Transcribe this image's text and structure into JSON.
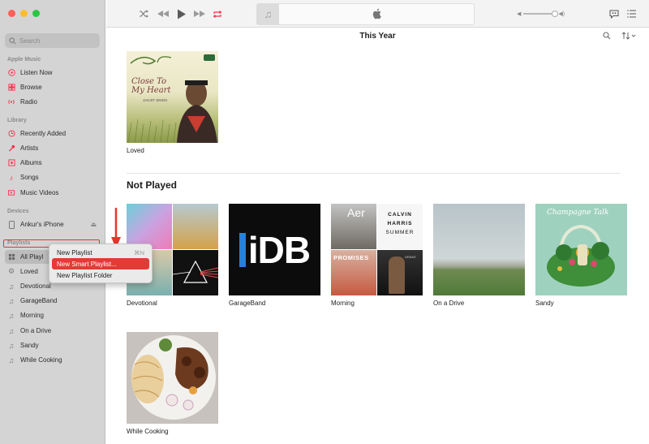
{
  "toolbar": {
    "lcd_title": "",
    "volume_level": 0.85
  },
  "sidebar": {
    "search_placeholder": "Search",
    "apple_music_label": "Apple Music",
    "apple_music_items": [
      {
        "label": "Listen Now",
        "icon": "play-circle-icon"
      },
      {
        "label": "Browse",
        "icon": "grid-icon"
      },
      {
        "label": "Radio",
        "icon": "radio-icon"
      }
    ],
    "library_label": "Library",
    "library_items": [
      {
        "label": "Recently Added",
        "icon": "clock-icon"
      },
      {
        "label": "Artists",
        "icon": "mic-icon"
      },
      {
        "label": "Albums",
        "icon": "album-icon"
      },
      {
        "label": "Songs",
        "icon": "note-icon"
      },
      {
        "label": "Music Videos",
        "icon": "video-icon"
      }
    ],
    "devices_label": "Devices",
    "device_name": "Ankur's iPhone",
    "playlists_label": "Playlists",
    "playlist_items": [
      {
        "label": "All Playlists"
      },
      {
        "label": "Loved"
      },
      {
        "label": "Devotional"
      },
      {
        "label": "GarageBand"
      },
      {
        "label": "Morning"
      },
      {
        "label": "On a Drive"
      },
      {
        "label": "Sandy"
      },
      {
        "label": "While Cooking"
      }
    ]
  },
  "context_menu": {
    "items": [
      {
        "label": "New Playlist",
        "shortcut": "⌘N"
      },
      {
        "label": "New Smart Playlist...",
        "shortcut": ""
      },
      {
        "label": "New Playlist Folder",
        "shortcut": ""
      }
    ],
    "selected_index": 1
  },
  "main": {
    "title": "This Year",
    "loved": {
      "label": "Loved",
      "cover_title": "Close To My Heart",
      "cover_artist": "JAGJIT SINGH"
    },
    "not_played_title": "Not Played",
    "albums": [
      {
        "label": "Devotional"
      },
      {
        "label": "GarageBand",
        "cover_text": "iDB"
      },
      {
        "label": "Morning",
        "cover_texts": [
          "Aer",
          "CALVIN",
          "HARRIS",
          "SUMMER",
          "PROMISES",
          "DRAKE"
        ]
      },
      {
        "label": "On a Drive"
      },
      {
        "label": "Sandy",
        "cover_text": "Champagne Talk"
      },
      {
        "label": "While Cooking"
      }
    ]
  },
  "colors": {
    "accent": "#fa2d48",
    "menu_selected": "#e33b35",
    "sidebar_bg": "#d4d4d4"
  }
}
